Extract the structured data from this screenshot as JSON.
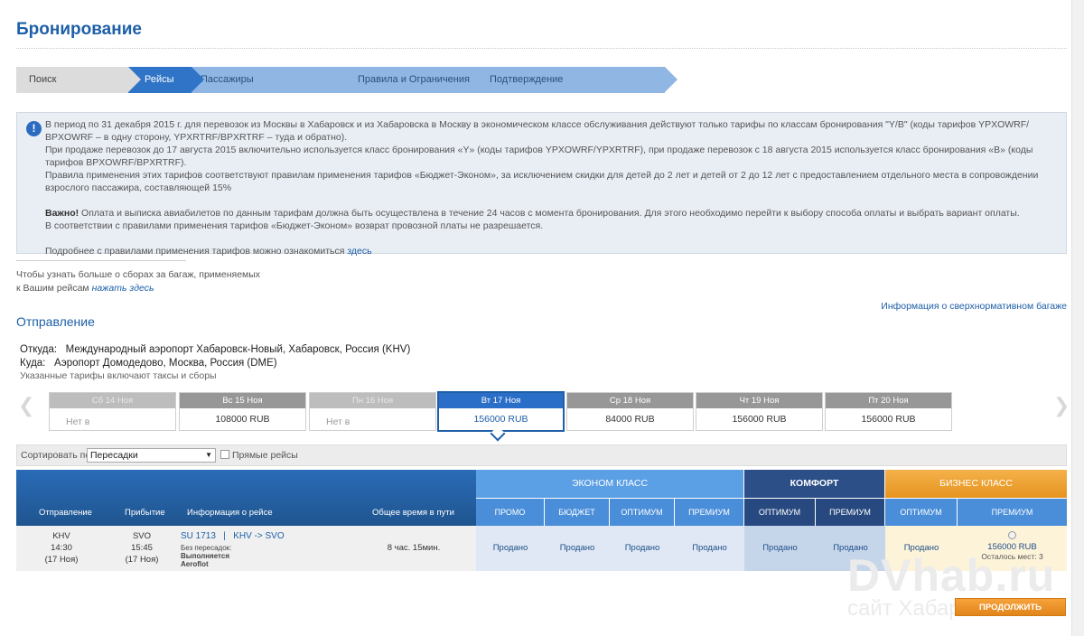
{
  "page": {
    "title": "Бронирование"
  },
  "steps": [
    {
      "label": "Поиск"
    },
    {
      "label": "Рейсы"
    },
    {
      "label": "Пассажиры"
    },
    {
      "label": "Правила и Ограничения"
    },
    {
      "label": "Подтверждение"
    }
  ],
  "info": {
    "icon": "exclamation-icon",
    "p1": "В период по 31 декабря 2015 г. для перевозок из Москвы в Хабаровск и из Хабаровска в Москву в экономическом классе обслуживания действуют только тарифы по классам бронирования \"Y/B\" (коды тарифов YPXOWRF/ BPXOWRF – в одну сторону, YPXRTRF/BPXRTRF – туда и обратно).",
    "p2": "При продаже перевозок до 17 августа 2015 включительно используется класс бронирования «Y» (коды тарифов YPXOWRF/YPXRTRF), при продаже перевозок с 18 августа 2015 используется класс бронирования «B» (коды тарифов BPXOWRF/BPXRTRF).",
    "p3": "Правила применения этих тарифов соответствуют правилам применения тарифов «Бюджет-Эконом», за исключением скидки для детей до 2 лет и детей от 2 до 12 лет с предоставлением отдельного места в сопровождении взрослого пассажира, составляющей 15%",
    "important_bold": "Важно!",
    "important_text": " Оплата и выписка авиабилетов по данным тарифам должна быть осуществлена в течение 24 часов с момента бронирования. Для этого необходимо перейти к выбору способа оплаты и выбрать вариант оплаты.",
    "p5": "В соответствии с правилами применения тарифов «Бюджет-Эконом» возврат провозной платы не разрешается.",
    "more_text": "Подробнее с правилами применения тарифов можно ознакомиться ",
    "more_link": "здесь"
  },
  "baggage": {
    "line1": "Чтобы узнать больше о сборах за багаж, применяемых",
    "line2": "к Вашим рейсам ",
    "link": "нажать здесь",
    "excess_link": "Информация о сверхнормативном багаже"
  },
  "departure": {
    "title": "Отправление",
    "from_label": "Откуда:",
    "from_value": "Международный аэропорт Хабаровск-Новый, Хабаровск, Россия (KHV)",
    "to_label": "Куда:",
    "to_value": "Аэропорт Домодедово, Москва, Россия (DME)",
    "note": "Указанные тарифы включают таксы и сборы"
  },
  "dates": [
    {
      "day": "Сб 14 Ноя",
      "price": "Нет в",
      "state": "muted"
    },
    {
      "day": "Вс 15 Ноя",
      "price": "108000 RUB",
      "state": "normal"
    },
    {
      "day": "Пн 16 Ноя",
      "price": "Нет в",
      "state": "muted"
    },
    {
      "day": "Вт 17 Ноя",
      "price": "156000 RUB",
      "state": "active"
    },
    {
      "day": "Ср 18 Ноя",
      "price": "84000 RUB",
      "state": "normal"
    },
    {
      "day": "Чт 19 Ноя",
      "price": "156000 RUB",
      "state": "normal"
    },
    {
      "day": "Пт 20 Ноя",
      "price": "156000 RUB",
      "state": "normal"
    }
  ],
  "sort": {
    "label": "Сортировать по",
    "selected": "Пересадки",
    "direct_label": "Прямые рейсы"
  },
  "table": {
    "headers": {
      "departure": "Отправление",
      "arrival": "Прибытие",
      "info": "Информация о рейсе",
      "duration": "Общее время в пути"
    },
    "classes": {
      "economy": "ЭКОНОМ КЛАСС",
      "comfort": "КОМФОРТ",
      "business": "БИЗНЕС КЛАСС"
    },
    "fares": {
      "promo": "ПРОМО",
      "budget": "БЮДЖЕТ",
      "optimum": "ОПТИМУМ",
      "premium": "ПРЕМИУМ",
      "comfort_optimum": "ОПТИМУМ",
      "comfort_premium": "ПРЕМИУМ",
      "business_optimum": "ОПТИМУМ",
      "business_premium": "ПРЕМИУМ"
    },
    "row": {
      "dep_code": "KHV",
      "dep_time": "14:30",
      "dep_date": "(17 Ноя)",
      "arr_code": "SVO",
      "arr_time": "15:45",
      "arr_date": "(17 Ноя)",
      "flight": "SU 1713",
      "divider": "|",
      "route": "KHV -> SVO",
      "stops": "Без пересадок:",
      "operated": "Выполняется",
      "carrier": "Aeroflot",
      "duration": "8 час. 15мин.",
      "sold": "Продано",
      "business_price": "156000 RUB",
      "seats_left": "Осталось мест: 3"
    },
    "colors": {
      "economy": "#5b9fe4",
      "comfort": "#2c4f88",
      "business": "#f0a22d",
      "economy_sub": "#4a8ed9",
      "comfort_sub": "#27497f",
      "business_sub": "#4a8ed9"
    }
  },
  "continue_button": "ПРОДОЛЖИТЬ",
  "watermark": {
    "brand": "DVhab.ru",
    "tagline": "сайт Хабаровска"
  }
}
